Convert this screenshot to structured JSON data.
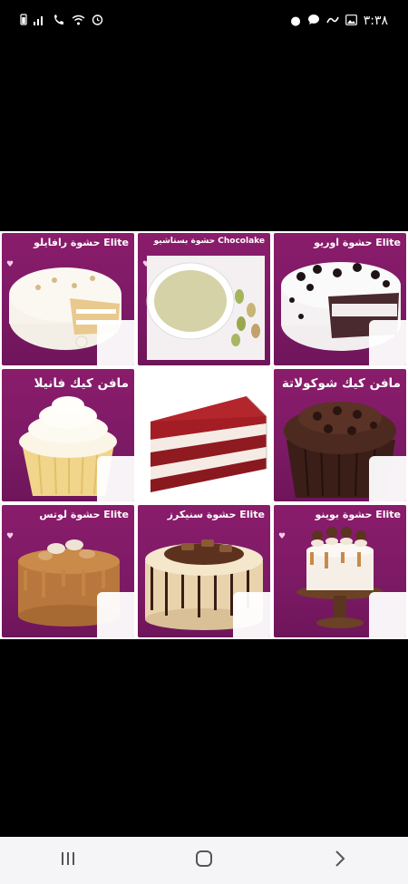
{
  "status_bar": {
    "time": "٣:٣٨",
    "left_icons": [
      "battery-icon",
      "signal-icon",
      "call-wifi-icon",
      "wifi-icon",
      "alarm-icon"
    ],
    "right_icons": [
      "dot-icon",
      "chat-icon",
      "snake-app-icon",
      "gallery-icon"
    ]
  },
  "tiles": [
    {
      "label": "حشوة رافايلو Elite"
    },
    {
      "label": "حشوة بستاشيو Chocolake"
    },
    {
      "label": "حشوة اوريو Elite"
    },
    {
      "label": "مافن كيك فانيلا"
    },
    {
      "label": ""
    },
    {
      "label": "مافن كيك شوكولاتة"
    },
    {
      "label": "حشوة لوتس Elite"
    },
    {
      "label": "حشوة سنيكرز Elite"
    },
    {
      "label": "حشوة بوينو Elite"
    }
  ],
  "colors": {
    "tile_purple": "#7d1a66",
    "background": "#000000",
    "nav_bar": "#f5f4f6"
  },
  "nav": {
    "icons": [
      "recent-apps-icon",
      "home-icon",
      "back-icon"
    ]
  }
}
